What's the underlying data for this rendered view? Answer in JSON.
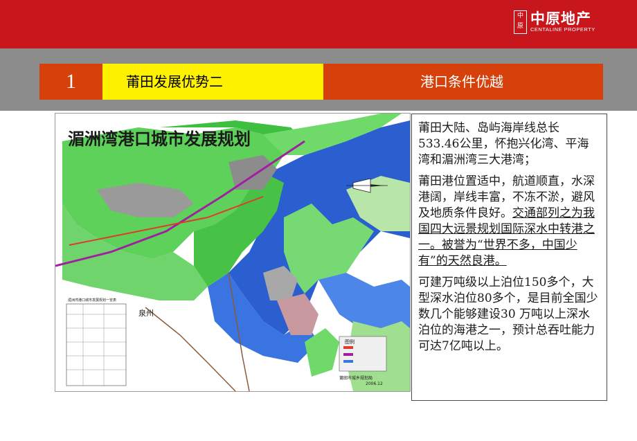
{
  "logo": {
    "seal_text": "中原",
    "name_cn": "中原地产",
    "name_en": "CENTALINE PROPERTY"
  },
  "header": {
    "number": "1",
    "title": "莆田发展优势二",
    "subtitle": "港口条件优越"
  },
  "map": {
    "title": "湄洲湾港口城市发展规划",
    "label_city": "泉州",
    "legend_title": "图例",
    "footer": "莆田市城乡规划局",
    "footer_date": "2006.12",
    "table_title": "湄洲湾港口城市发展规划一览表"
  },
  "body": {
    "p1": "莆田大陆、岛屿海岸线总长533.46公里，怀抱兴化湾、平海湾和湄洲湾三大港湾；",
    "p2_plain": "莆田港位置适中，航道顺直，水深港阔，岸线丰富，不冻不淤，避风及地质条件良好。",
    "p2_underlined": "交通部列之为我国四大远景规划国际深水中转港之一。被誉为“世界不多，中国少有”的天然良港。",
    "p3": "可建万吨级以上泊位150多个，大型深水泊位80多个，是目前全国少数几个能够建设30 万吨以上深水泊位的海港之一，预计总吞吐能力可达7亿吨以上。"
  },
  "colors": {
    "top_red": "#c8161d",
    "gray": "#8d8c8c",
    "orange": "#d5400b",
    "yellow": "#fff200"
  }
}
